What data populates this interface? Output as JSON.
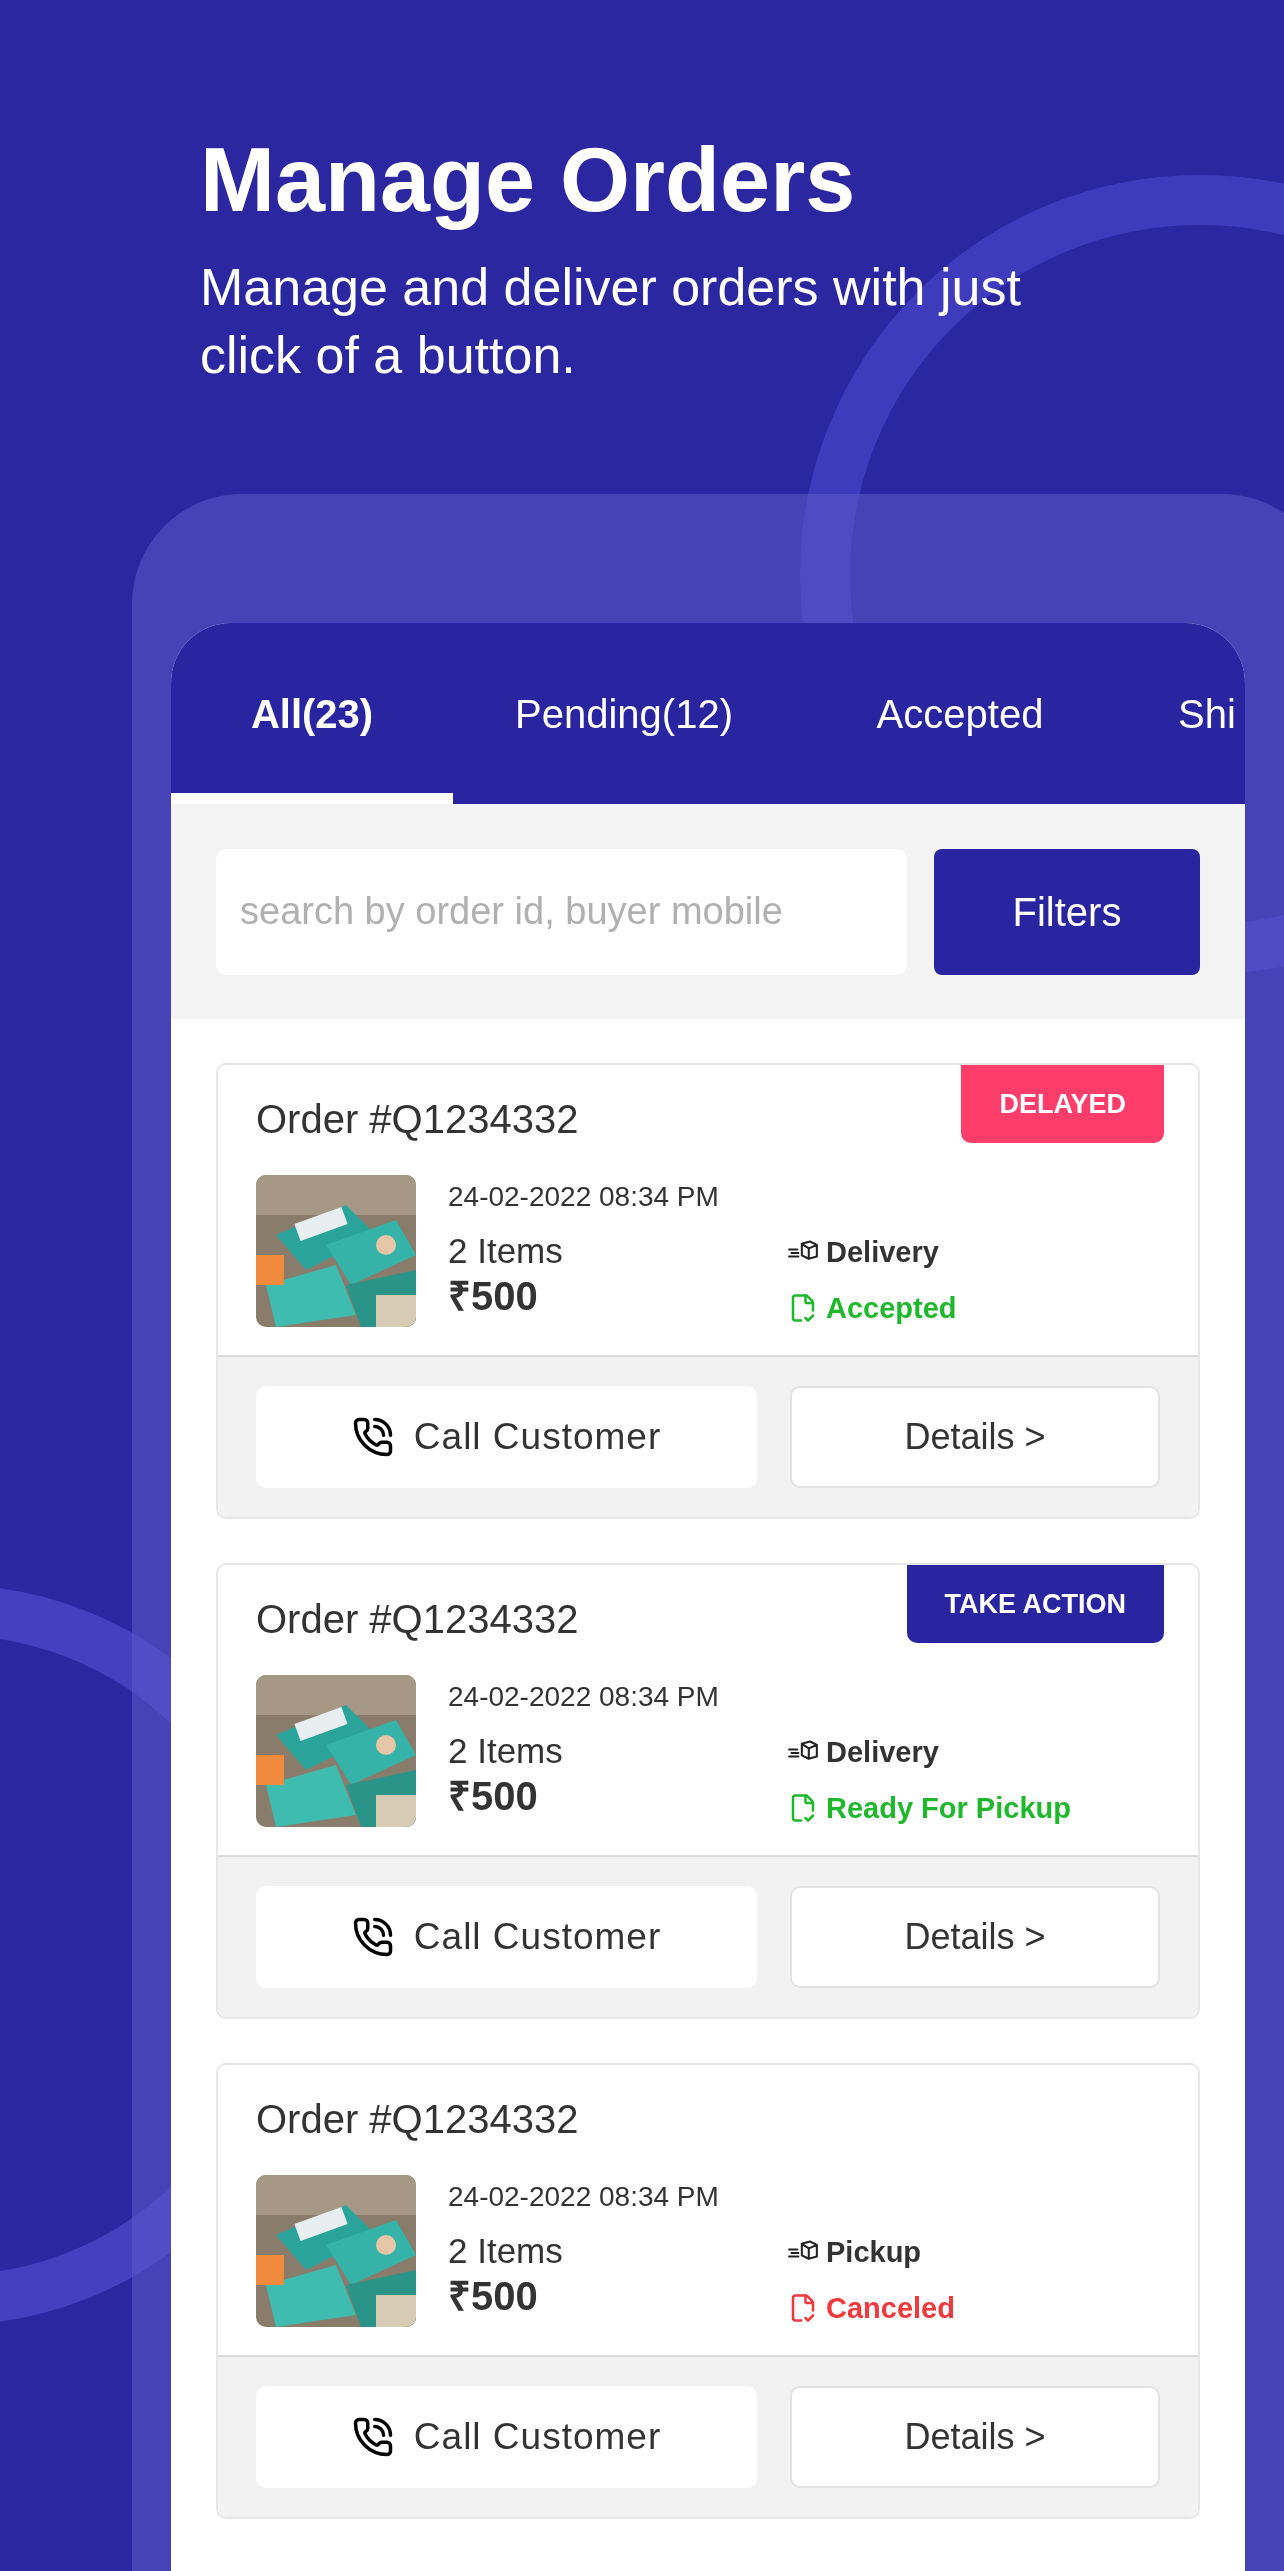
{
  "header": {
    "title": "Manage Orders",
    "subtitle": "Manage and deliver orders with just click of a button."
  },
  "tabs": [
    {
      "label": "All(23)",
      "selected": true
    },
    {
      "label": "Pending(12)",
      "selected": false
    },
    {
      "label": "Accepted",
      "selected": false
    },
    {
      "label": "Shi",
      "selected": false
    }
  ],
  "search": {
    "placeholder": "search by order id, buyer mobile"
  },
  "filters_button": "Filters",
  "orders": [
    {
      "title": "Order #Q1234332",
      "badge": {
        "label": "DELAYED",
        "kind": "alert"
      },
      "date": "24-02-2022 08:34 PM",
      "items": "2 Items",
      "price": "₹500",
      "method": "Delivery",
      "status": {
        "label": "Accepted",
        "color": "#1fb82d"
      },
      "call": "Call Customer",
      "details": "Details >"
    },
    {
      "title": "Order #Q1234332",
      "badge": {
        "label": "TAKE ACTION",
        "kind": "action"
      },
      "date": "24-02-2022 08:34 PM",
      "items": "2 Items",
      "price": "₹500",
      "method": "Delivery",
      "status": {
        "label": "Ready For Pickup",
        "color": "#1fb82d"
      },
      "call": "Call Customer",
      "details": "Details >"
    },
    {
      "title": "Order #Q1234332",
      "date": "24-02-2022 08:34 PM",
      "items": "2 Items",
      "price": "₹500",
      "method": "Pickup",
      "status": {
        "label": "Canceled",
        "color": "#f0393d"
      },
      "call": "Call Customer",
      "details": "Details >"
    }
  ]
}
